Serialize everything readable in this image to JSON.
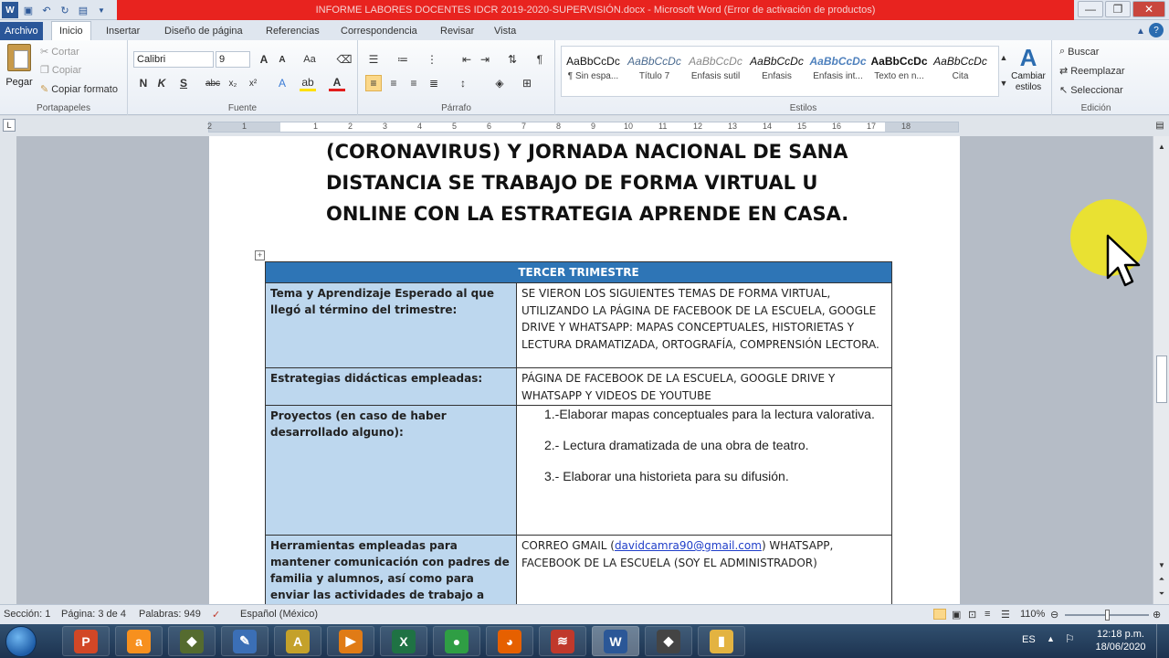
{
  "window": {
    "title": "INFORME LABORES DOCENTES IDCR 2019-2020-SUPERVISIÓN.docx - Microsoft Word (Error de activación de productos)"
  },
  "tabs": [
    {
      "label": "Archivo"
    },
    {
      "label": "Inicio"
    },
    {
      "label": "Insertar"
    },
    {
      "label": "Diseño de página"
    },
    {
      "label": "Referencias"
    },
    {
      "label": "Correspondencia"
    },
    {
      "label": "Revisar"
    },
    {
      "label": "Vista"
    }
  ],
  "ribbon": {
    "clipboard": {
      "paste": "Pegar",
      "cut": "Cortar",
      "copy": "Copiar",
      "format_painter": "Copiar formato",
      "label": "Portapapeles"
    },
    "font": {
      "name": "Calibri",
      "size": "9",
      "label": "Fuente"
    },
    "paragraph": {
      "label": "Párrafo"
    },
    "styles": {
      "label": "Estilos",
      "items": [
        {
          "sample": "AaBbCcDc",
          "name": "¶ Sin espa..."
        },
        {
          "sample": "AaBbCcDc",
          "name": "Título 7"
        },
        {
          "sample": "AaBbCcDc",
          "name": "Énfasis sutil"
        },
        {
          "sample": "AaBbCcDc",
          "name": "Énfasis"
        },
        {
          "sample": "AaBbCcDc",
          "name": "Énfasis int..."
        },
        {
          "sample": "AaBbCcDc",
          "name": "Texto en n..."
        },
        {
          "sample": "AaBbCcDc",
          "name": "Cita"
        }
      ],
      "change": "Cambiar estilos"
    },
    "editing": {
      "find": "Buscar",
      "replace": "Reemplazar",
      "select": "Seleccionar",
      "label": "Edición"
    }
  },
  "ruler": {
    "numbers": [
      "2",
      "1",
      "1",
      "2",
      "3",
      "4",
      "5",
      "6",
      "7",
      "8",
      "9",
      "10",
      "11",
      "12",
      "13",
      "14",
      "15",
      "16",
      "17",
      "18"
    ]
  },
  "document": {
    "heading_lines": [
      "(CORONAVIRUS) Y JORNADA NACIONAL DE SANA",
      "DISTANCIA SE TRABAJO DE FORMA VIRTUAL U",
      "ONLINE CON LA ESTRATEGIA APRENDE EN CASA."
    ],
    "table": {
      "header": "TERCER TRIMESTRE",
      "rows": [
        {
          "label": "Tema y Aprendizaje Esperado al que llegó al término del trimestre:",
          "value": "SE VIERON LOS SIGUIENTES  TEMAS DE FORMA VIRTUAL, UTILIZANDO LA PÁGINA DE FACEBOOK DE LA ESCUELA, GOOGLE DRIVE Y WHATSAPP:  MAPAS CONCEPTUALES, HISTORIETAS Y LECTURA DRAMATIZADA, ORTOGRAFÍA, COMPRENSIÓN LECTORA."
        },
        {
          "label": "Estrategias didácticas empleadas:",
          "value": "PÁGINA  DE FACEBOOK DE LA ESCUELA, GOOGLE DRIVE Y WHATSAPP  Y VIDEOS DE YOUTUBE"
        },
        {
          "label": "Proyectos (en caso de haber desarrollado alguno):",
          "items": [
            "1.-Elaborar mapas conceptuales para la lectura valorativa.",
            "2.- Lectura dramatizada de una obra de teatro.",
            "3.- Elaborar una historieta para su difusión."
          ]
        },
        {
          "label": "Herramientas empleadas para mantener comunicación con padres de familia y alumnos, así como para enviar las actividades de trabajo a distancia:",
          "prefix": "CORREO GMAIL (",
          "link": "davidcamra90@gmail.com",
          "suffix": ") WHATSAPP, FACEBOOK DE LA ESCUELA (SOY EL ADMINISTRADOR)"
        }
      ]
    }
  },
  "status": {
    "section": "Sección: 1",
    "page": "Página: 3 de 4",
    "words": "Palabras: 949",
    "language": "Español (México)",
    "zoom": "110%"
  },
  "taskbar": {
    "lang": "ES",
    "time": "12:18 p.m.",
    "date": "18/06/2020",
    "apps": [
      {
        "name": "powerpoint",
        "glyph": "P",
        "color": "#d24726"
      },
      {
        "name": "avast",
        "glyph": "a",
        "color": "#f7901e"
      },
      {
        "name": "app-3",
        "glyph": "◆",
        "color": "#556b2f"
      },
      {
        "name": "app-4",
        "glyph": "✎",
        "color": "#3b6fb6"
      },
      {
        "name": "app-5",
        "glyph": "A",
        "color": "#c4a12a"
      },
      {
        "name": "media",
        "glyph": "▶",
        "color": "#e07b16"
      },
      {
        "name": "excel",
        "glyph": "X",
        "color": "#1f7244"
      },
      {
        "name": "chrome",
        "glyph": "●",
        "color": "#2f9e44"
      },
      {
        "name": "firefox",
        "glyph": "◕",
        "color": "#e66000"
      },
      {
        "name": "app-10",
        "glyph": "≋",
        "color": "#c0392b"
      },
      {
        "name": "word",
        "glyph": "W",
        "color": "#2b5797"
      },
      {
        "name": "app-12",
        "glyph": "◆",
        "color": "#444"
      },
      {
        "name": "explorer",
        "glyph": "▮",
        "color": "#e3b341"
      }
    ]
  }
}
